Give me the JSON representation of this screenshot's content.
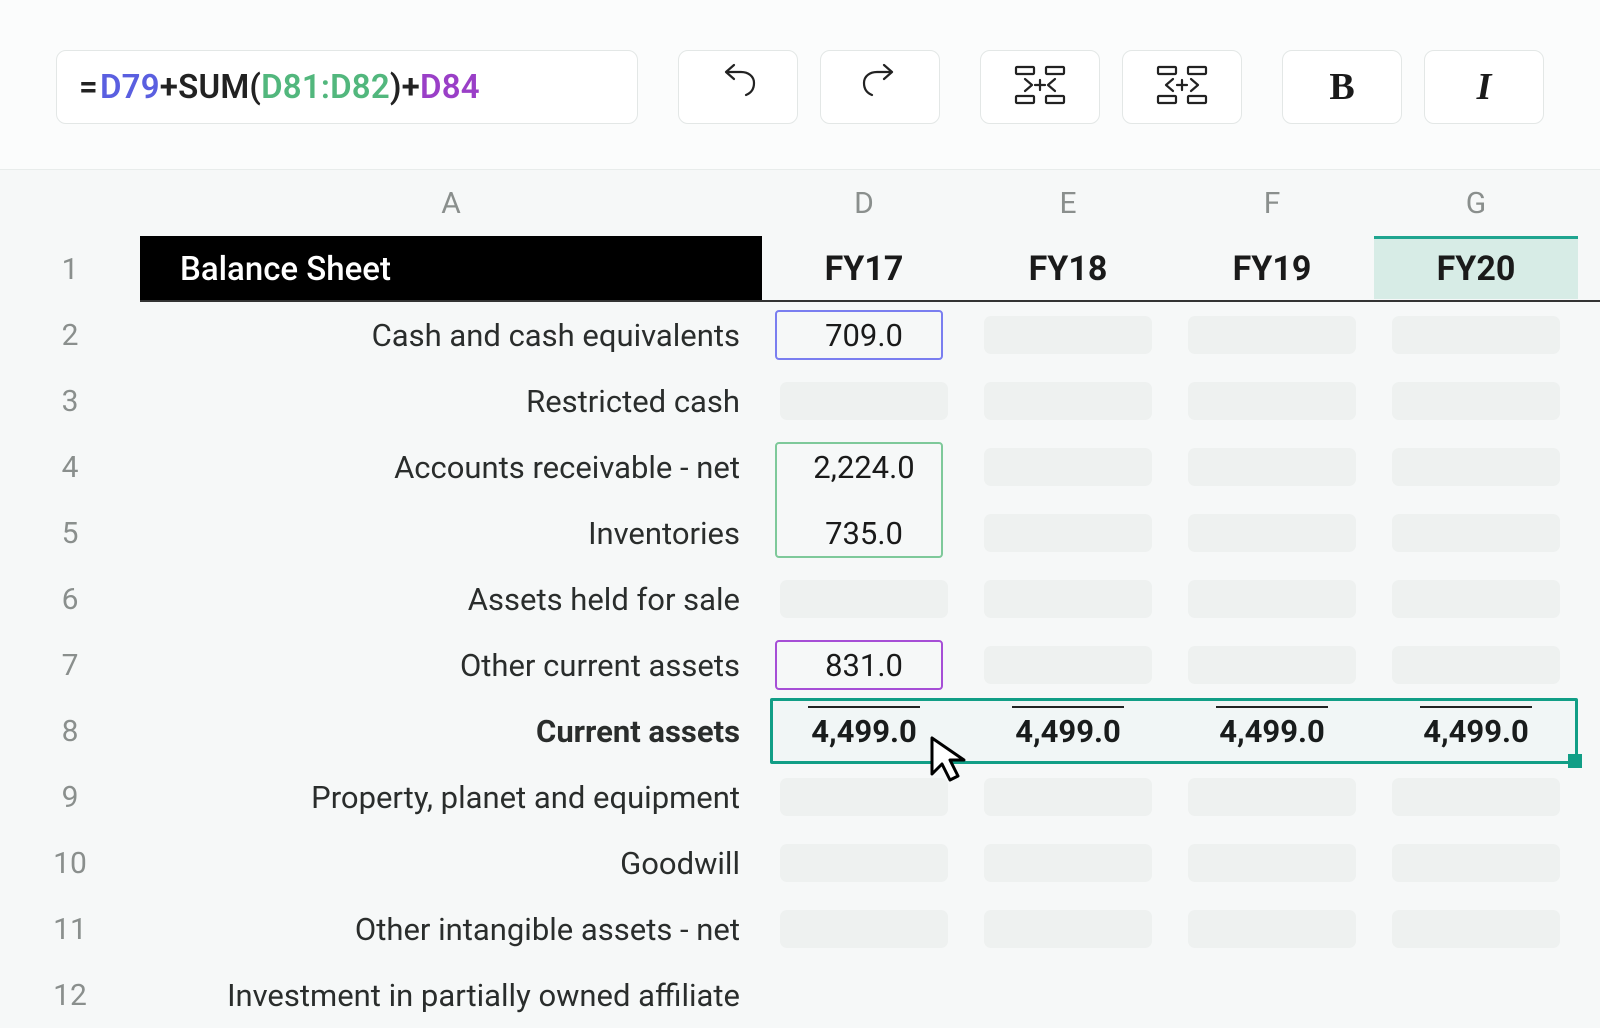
{
  "formula": {
    "prefix": "=",
    "ref1": "D79",
    "plus1": "+",
    "fn": "SUM(",
    "ref2": "D81:D82",
    "close": ")",
    "plus2": "+",
    "ref3": "D84"
  },
  "columns": {
    "A": "A",
    "D": "D",
    "E": "E",
    "F": "F",
    "G": "G"
  },
  "rows": [
    "1",
    "2",
    "3",
    "4",
    "5",
    "6",
    "7",
    "8",
    "9",
    "10",
    "11",
    "12"
  ],
  "header": {
    "title": "Balance Sheet",
    "fy17": "FY17",
    "fy18": "FY18",
    "fy19": "FY19",
    "fy20": "FY20"
  },
  "labels": {
    "r2": "Cash and cash equivalents",
    "r3": "Restricted cash",
    "r4": "Accounts receivable - net",
    "r5": "Inventories",
    "r6": "Assets held for sale",
    "r7": "Other current assets",
    "r8": "Current assets",
    "r9": "Property, planet and equipment",
    "r10": "Goodwill",
    "r11": "Other intangible assets - net",
    "r12": "Investment in partially owned affiliate"
  },
  "values": {
    "d2": "709.0",
    "d4": "2,224.0",
    "d5": "735.0",
    "d7": "831.0",
    "d8": "4,499.0",
    "e8": "4,499.0",
    "f8": "4,499.0",
    "g8": "4,499.0"
  },
  "toolbar": {
    "bold_label": "B",
    "italic_label": "I"
  }
}
